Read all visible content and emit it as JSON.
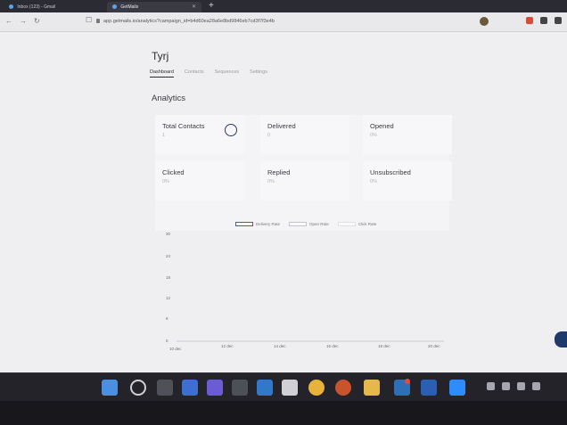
{
  "browser": {
    "tabs": [
      {
        "label": "Inbox (123) - Gmail"
      },
      {
        "label": "GetMails"
      }
    ],
    "new_tab": "+",
    "url": "app.getmails.io/analytics?campaign_id=b4d60ea28a6e8bd9846eb7cd3f7f3e4b"
  },
  "app": {
    "title": "Tyrj",
    "tabs": [
      "Dashboard",
      "Contacts",
      "Sequences",
      "Settings"
    ],
    "active_tab": "Dashboard"
  },
  "analytics": {
    "title": "Analytics",
    "stats": [
      {
        "label": "Total Contacts",
        "value": "1"
      },
      {
        "label": "Delivered",
        "value": "0"
      },
      {
        "label": "Opened",
        "value": "0%"
      },
      {
        "label": "Clicked",
        "value": "0%"
      },
      {
        "label": "Replied",
        "value": "0%"
      },
      {
        "label": "Unsubscribed",
        "value": "0%"
      }
    ]
  },
  "chart_data": {
    "type": "line",
    "series": [
      {
        "name": "Delivery Rate",
        "values": [
          0,
          0,
          0,
          0,
          0,
          0
        ]
      },
      {
        "name": "Open Rate",
        "values": [
          0,
          0,
          0,
          0,
          0,
          0
        ]
      },
      {
        "name": "Click Rate",
        "values": [
          0,
          0,
          0,
          0,
          0,
          0
        ]
      }
    ],
    "categories": [
      "10 dec",
      "12 dec",
      "14 dec",
      "16 dec",
      "18 dec",
      "20 dec"
    ],
    "y_ticks": [
      "30",
      "24",
      "18",
      "12",
      "6",
      "0"
    ],
    "ylim": [
      0,
      30
    ],
    "grid": false,
    "legend": "top"
  },
  "colors": {
    "accent": "#2e3a67",
    "delivery": "#4a5ab0"
  }
}
